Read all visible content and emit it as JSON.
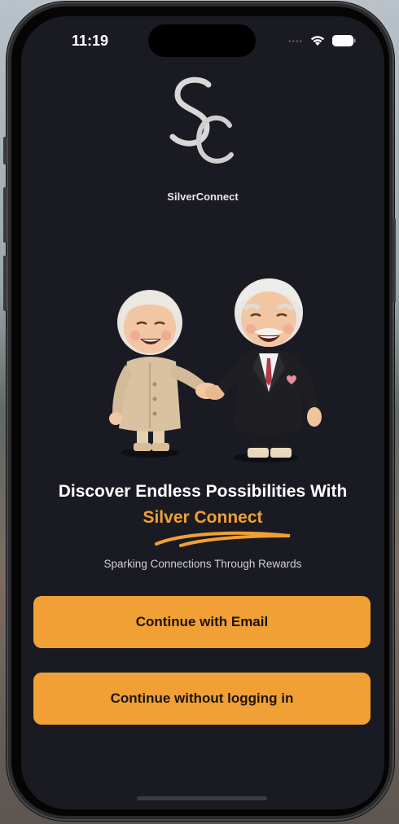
{
  "status_bar": {
    "time": "11:19",
    "signal_icon": "signal-dots-icon",
    "wifi_icon": "wifi-icon",
    "battery_icon": "battery-icon"
  },
  "brand": {
    "logo_monogram": "SC",
    "app_name": "SilverConnect"
  },
  "illustration": {
    "icon": "elderly-couple-handshake-illustration"
  },
  "hero": {
    "headline": "Discover Endless Possibilities With",
    "highlight": "Silver Connect",
    "tagline": "Sparking Connections Through Rewards"
  },
  "actions": {
    "continue_email_label": "Continue with Email",
    "continue_guest_label": "Continue without logging in"
  },
  "colors": {
    "background": "#1a1b22",
    "accent": "#f0a035",
    "button_text": "#1c1406",
    "text_primary": "#ffffff",
    "text_secondary": "#d0d0d4"
  }
}
